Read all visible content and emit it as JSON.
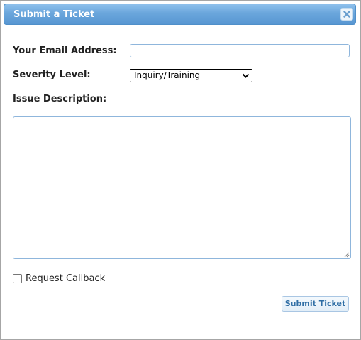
{
  "dialog": {
    "title": "Submit a Ticket",
    "close_icon": "close-icon"
  },
  "form": {
    "email_label": "Your Email Address:",
    "email_value": "",
    "severity_label": "Severity Level:",
    "severity_selected": "Inquiry/Training",
    "description_label": "Issue Description:",
    "description_value": "",
    "callback_label": "Request Callback",
    "callback_checked": false,
    "submit_label": "Submit Ticket"
  },
  "colors": {
    "titlebar": "#6aa6dc",
    "accent": "#2f6ea5",
    "input_border": "#8fb6dc"
  }
}
